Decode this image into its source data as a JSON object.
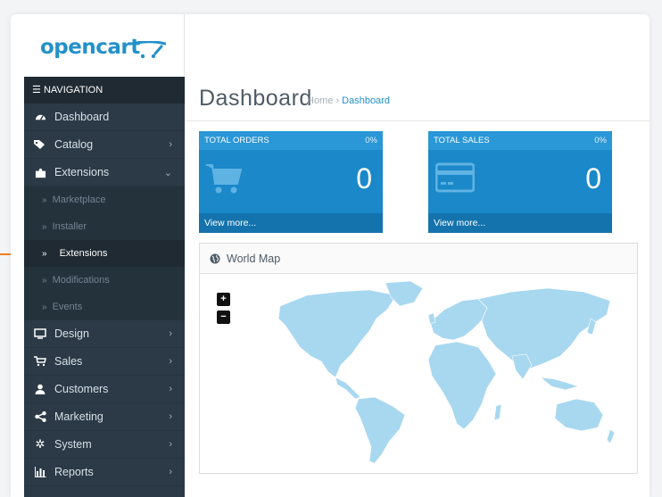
{
  "logo": {
    "text": "opencart"
  },
  "navigation": {
    "header": "NAVIGATION",
    "items": [
      {
        "label": "Dashboard",
        "icon": "dashboard-icon",
        "has_children": false
      },
      {
        "label": "Catalog",
        "icon": "tag-icon",
        "has_children": true
      },
      {
        "label": "Extensions",
        "icon": "puzzle-icon",
        "has_children": true,
        "expanded": true
      },
      {
        "label": "Design",
        "icon": "monitor-icon",
        "has_children": true
      },
      {
        "label": "Sales",
        "icon": "cart-icon",
        "has_children": true
      },
      {
        "label": "Customers",
        "icon": "user-icon",
        "has_children": true
      },
      {
        "label": "Marketing",
        "icon": "share-icon",
        "has_children": true
      },
      {
        "label": "System",
        "icon": "gear-icon",
        "has_children": true
      },
      {
        "label": "Reports",
        "icon": "bar-chart-icon",
        "has_children": true
      }
    ],
    "extensions_sub": [
      {
        "label": "Marketplace",
        "active": false
      },
      {
        "label": "Installer",
        "active": false
      },
      {
        "label": "Extensions",
        "active": true
      },
      {
        "label": "Modifications",
        "active": false
      },
      {
        "label": "Events",
        "active": false
      }
    ]
  },
  "header": {
    "title": "Dashboard",
    "breadcrumb": {
      "home": "Home",
      "separator": "›",
      "current": "Dashboard"
    }
  },
  "tiles": {
    "orders": {
      "title": "TOTAL ORDERS",
      "percent": "0%",
      "value": "0",
      "footer": "View more..."
    },
    "sales": {
      "title": "TOTAL SALES",
      "percent": "0%",
      "value": "0",
      "footer": "View more..."
    }
  },
  "map": {
    "title": "World Map",
    "zoom_in": "+",
    "zoom_out": "−"
  },
  "colors": {
    "brand": "#2391c9",
    "sidebar": "#2b3a46",
    "tile": "#1f8dce",
    "map_land": "#a8d8f0",
    "indicator": "#f07f1b"
  }
}
